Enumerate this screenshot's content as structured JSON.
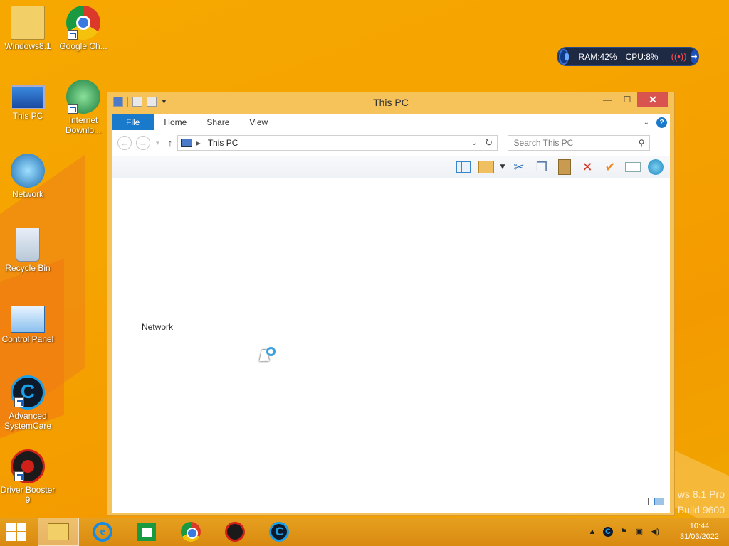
{
  "desktop": {
    "icons": [
      {
        "label": "Windows8.1"
      },
      {
        "label": "Google Ch..."
      },
      {
        "label": "This PC"
      },
      {
        "label": "Internet Downlo..."
      },
      {
        "label": "Network"
      },
      {
        "label": "Recycle Bin"
      },
      {
        "label": "Control Panel"
      },
      {
        "label": "Advanced SystemCare"
      },
      {
        "label": "Driver Booster 9"
      }
    ],
    "watermark": {
      "line1": "ws 8.1 Pro",
      "line2": "Build 9600"
    }
  },
  "widget": {
    "ram": "RAM:42%",
    "cpu": "CPU:8%"
  },
  "window": {
    "title": "This PC",
    "controls": {
      "minimize": "—",
      "maximize": "☐",
      "close": "✕"
    },
    "ribbon_tabs": [
      "File",
      "Home",
      "Share",
      "View"
    ],
    "address": {
      "location": "This PC"
    },
    "search": {
      "placeholder": "Search This PC"
    },
    "content": {
      "group_label": "Network"
    }
  },
  "taskbar": {
    "clock": {
      "time": "10:44",
      "date": "31/03/2022"
    }
  },
  "colors": {
    "accent": "#1979ca",
    "desktop_bg": "#f5a300",
    "close_red": "#d9534f"
  }
}
